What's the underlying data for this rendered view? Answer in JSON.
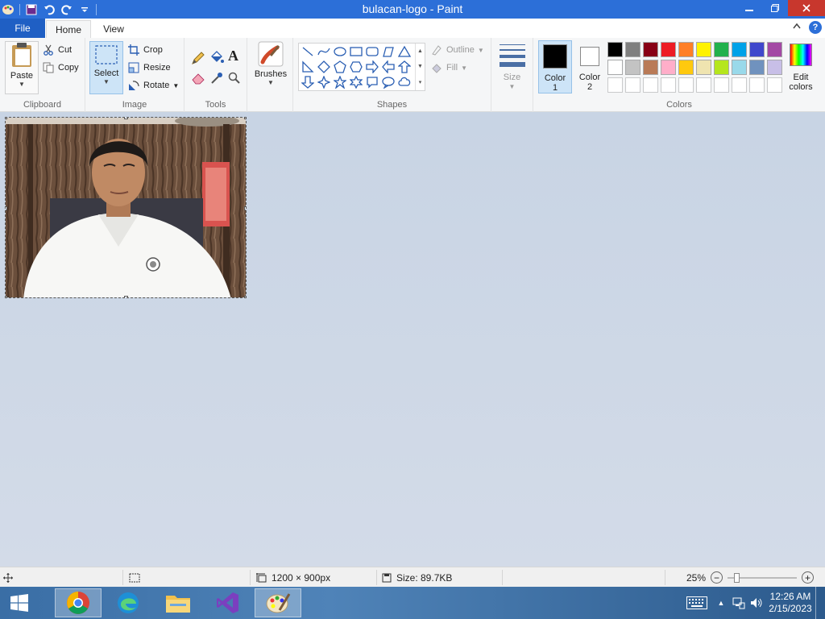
{
  "titlebar": {
    "title": "bulacan-logo - Paint"
  },
  "tabs": {
    "file": "File",
    "home": "Home",
    "view": "View"
  },
  "ribbon": {
    "clipboard": {
      "label": "Clipboard",
      "paste": "Paste",
      "cut": "Cut",
      "copy": "Copy"
    },
    "image": {
      "label": "Image",
      "select": "Select",
      "crop": "Crop",
      "resize": "Resize",
      "rotate": "Rotate"
    },
    "tools": {
      "label": "Tools"
    },
    "brushes": {
      "label": "Brushes"
    },
    "shapes": {
      "label": "Shapes",
      "outline": "Outline",
      "fill": "Fill"
    },
    "size": {
      "label": "Size"
    },
    "colors": {
      "label": "Colors",
      "color1_line1": "Color",
      "color1_line2": "1",
      "color2_line1": "Color",
      "color2_line2": "2",
      "edit_line1": "Edit",
      "edit_line2": "colors",
      "color1_value": "#000000",
      "color2_value": "#ffffff",
      "palette_row1": [
        "#000000",
        "#7f7f7f",
        "#880015",
        "#ed1c24",
        "#ff7f27",
        "#fff200",
        "#22b14c",
        "#00a2e8",
        "#3f48cc",
        "#a349a4"
      ],
      "palette_row2": [
        "#ffffff",
        "#c3c3c3",
        "#b97a57",
        "#ffaec9",
        "#ffc90e",
        "#efe4b0",
        "#b5e61d",
        "#99d9ea",
        "#7092be",
        "#c8bfe7"
      ],
      "palette_row3": [
        "#ffffff",
        "#ffffff",
        "#ffffff",
        "#ffffff",
        "#ffffff",
        "#ffffff",
        "#ffffff",
        "#ffffff",
        "#ffffff",
        "#ffffff"
      ]
    }
  },
  "status": {
    "dimensions": "1200 × 900px",
    "size": "Size: 89.7KB",
    "zoom": "25%",
    "zoom_level": 0.1
  },
  "taskbar": {
    "time": "12:26 AM",
    "date": "2/15/2023"
  }
}
